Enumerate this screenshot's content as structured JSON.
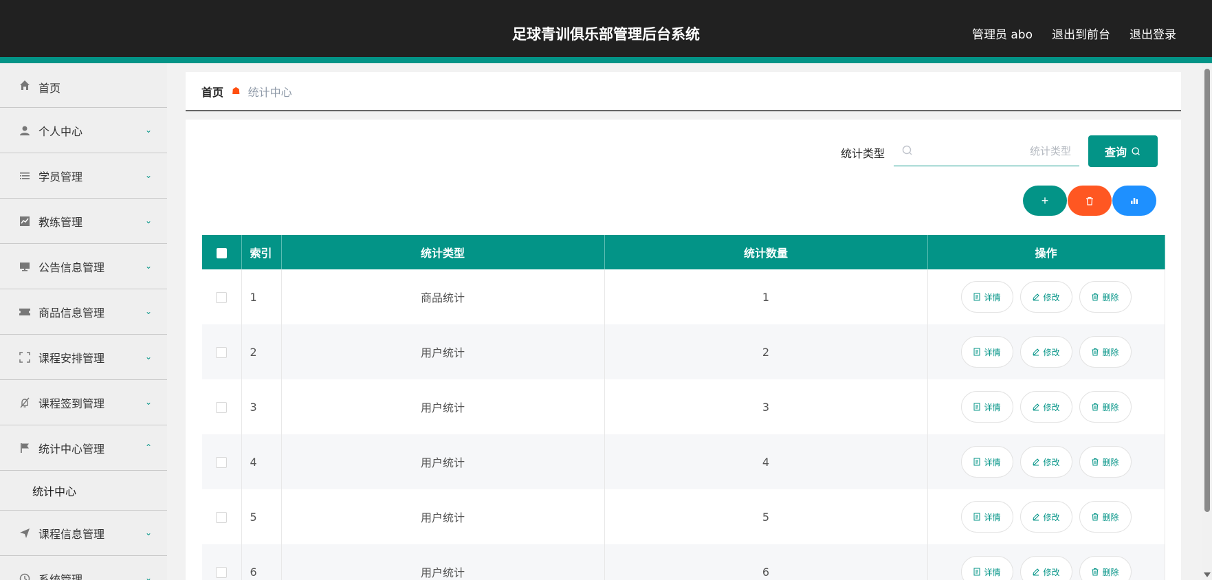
{
  "header": {
    "title": "足球青训俱乐部管理后台系统",
    "admin": "管理员 abo",
    "to_front": "退出到前台",
    "logout": "退出登录"
  },
  "sidebar": {
    "items": [
      {
        "label": "首页",
        "icon": "home-icon"
      },
      {
        "label": "个人中心",
        "icon": "user-icon"
      },
      {
        "label": "学员管理",
        "icon": "list-icon"
      },
      {
        "label": "教练管理",
        "icon": "chart-icon"
      },
      {
        "label": "公告信息管理",
        "icon": "monitor-icon"
      },
      {
        "label": "商品信息管理",
        "icon": "ticket-icon"
      },
      {
        "label": "课程安排管理",
        "icon": "fullscreen-icon"
      },
      {
        "label": "课程签到管理",
        "icon": "bell-off-icon"
      },
      {
        "label": "统计中心管理",
        "icon": "flag-icon"
      },
      {
        "label": "统计中心"
      },
      {
        "label": "课程信息管理",
        "icon": "send-icon"
      },
      {
        "label": "系统管理",
        "icon": "clock-icon"
      }
    ]
  },
  "breadcrumb": {
    "home": "首页",
    "current": "统计中心"
  },
  "search": {
    "label": "统计类型",
    "placeholder": "统计类型",
    "value": "",
    "button": "查询"
  },
  "actions": {
    "add": "+"
  },
  "table": {
    "headers": {
      "index": "索引",
      "type": "统计类型",
      "count": "统计数量",
      "ops": "操作"
    },
    "op_labels": {
      "detail": "详情",
      "edit": "修改",
      "delete": "删除"
    },
    "rows": [
      {
        "index": "1",
        "type": "商品统计",
        "count": "1"
      },
      {
        "index": "2",
        "type": "用户统计",
        "count": "2"
      },
      {
        "index": "3",
        "type": "用户统计",
        "count": "3"
      },
      {
        "index": "4",
        "type": "用户统计",
        "count": "4"
      },
      {
        "index": "5",
        "type": "用户统计",
        "count": "5"
      },
      {
        "index": "6",
        "type": "用户统计",
        "count": "6"
      }
    ]
  },
  "colors": {
    "accent": "#039487",
    "header_bg": "#212121",
    "danger": "#ff5722",
    "info": "#1e90ff",
    "crumb_sep": "#ff4f10"
  }
}
